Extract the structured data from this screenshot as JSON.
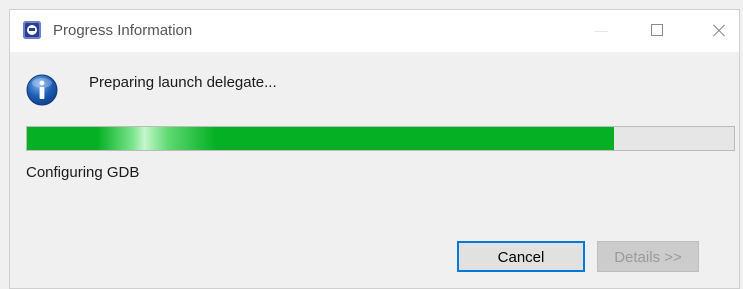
{
  "window": {
    "title": "Progress Information",
    "icon": "eclipse-app-icon",
    "controls": [
      "minimize",
      "maximize",
      "close"
    ]
  },
  "message": "Preparing launch delegate...",
  "progress": {
    "fraction": 0.83,
    "fill_color": "#06b025"
  },
  "subtask": "Configuring GDB",
  "buttons": {
    "cancel": "Cancel",
    "details": "Details >>"
  },
  "colors": {
    "focus_border": "#0078d7",
    "progress_green": "#06b025",
    "info_icon_blue": "#1f5fb5"
  }
}
